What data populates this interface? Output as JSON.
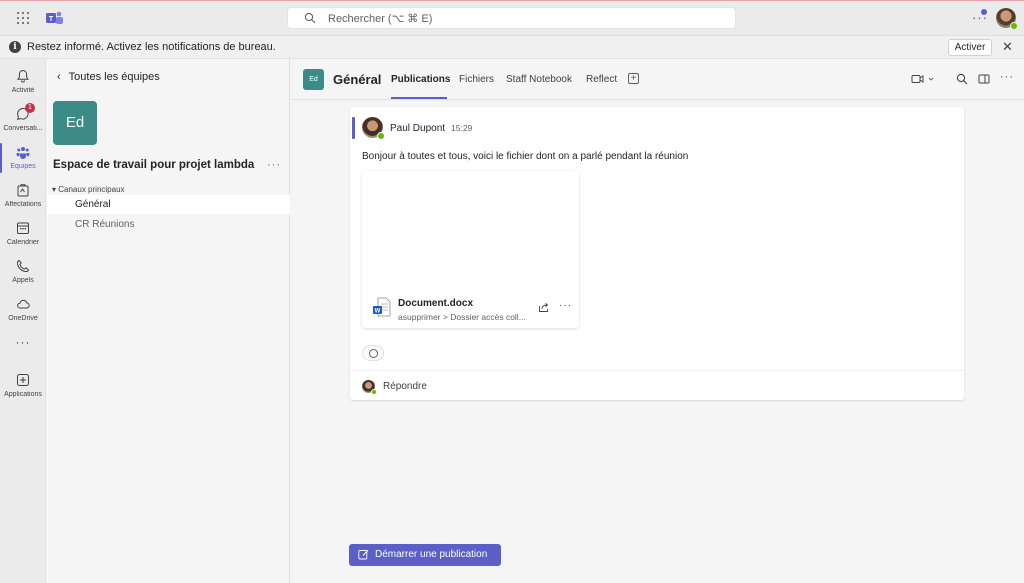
{
  "titlebar": {
    "search_placeholder": "Rechercher (⌥ ⌘ E)",
    "more_label": "···"
  },
  "banner": {
    "text": "Restez informé. Activez les notifications de bureau.",
    "activate_label": "Activer",
    "close_label": "✕"
  },
  "rail": {
    "items": [
      {
        "label": "Activité",
        "icon": "bell-icon"
      },
      {
        "label": "Conversati...",
        "icon": "chat-icon",
        "badge": "1"
      },
      {
        "label": "Équipes",
        "icon": "teams-icon",
        "active": true
      },
      {
        "label": "Affectations",
        "icon": "assignments-icon"
      },
      {
        "label": "Calendrier",
        "icon": "calendar-icon"
      },
      {
        "label": "Appels",
        "icon": "phone-icon"
      },
      {
        "label": "OneDrive",
        "icon": "cloud-icon"
      },
      {
        "label": "···",
        "icon": "more-icon"
      },
      {
        "label": "Applications",
        "icon": "add-app-icon"
      }
    ]
  },
  "teampanel": {
    "back_label": "Toutes les équipes",
    "avatar_text": "Ed",
    "team_name": "Espace de travail pour projet lambda",
    "more_label": "···",
    "section_header": "Canaux principaux",
    "channels": [
      "Général",
      "CR Réunions"
    ]
  },
  "header": {
    "avatar_text": "Ed",
    "title": "Général",
    "tabs": [
      "Publications",
      "Fichiers",
      "Staff Notebook",
      "Reflect"
    ],
    "add_tab_label": "+"
  },
  "post": {
    "author": "Paul Dupont",
    "time": "15:29",
    "message": "Bonjour à toutes et tous, voici le fichier dont on a parlé pendant la réunion",
    "file": {
      "name": "Document.docx",
      "path": "asupprimer > Dossier accès coll...",
      "more_label": "···"
    },
    "reply_label": "Répondre"
  },
  "new_post_label": "Démarrer une publication",
  "colors": {
    "accent": "#5b5fc7",
    "team_avatar": "#3d8b86",
    "presence": "#6bb700",
    "badge": "#c4314b"
  }
}
